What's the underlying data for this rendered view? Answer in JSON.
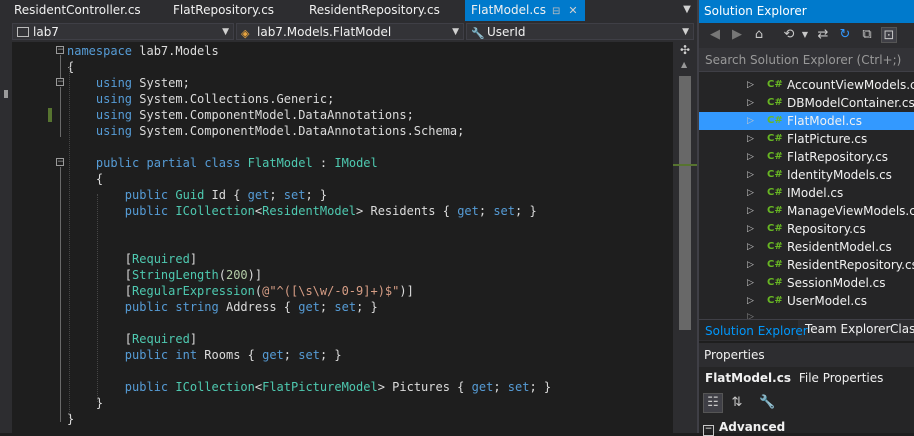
{
  "tabs": [
    {
      "label": "ResidentController.cs",
      "active": false
    },
    {
      "label": "FlatRepository.cs",
      "active": false
    },
    {
      "label": "ResidentRepository.cs",
      "active": false
    },
    {
      "label": "FlatModel.cs",
      "active": true
    }
  ],
  "navbar": {
    "project": "lab7",
    "type": "lab7.Models.FlatModel",
    "member": "UserId"
  },
  "code_lines": [
    [
      {
        "c": "kw",
        "t": "namespace"
      },
      {
        "c": "pl",
        "t": " lab7.Models"
      }
    ],
    [
      {
        "c": "pl",
        "t": "{"
      }
    ],
    [
      {
        "c": "pl",
        "t": "    "
      },
      {
        "c": "kw",
        "t": "using"
      },
      {
        "c": "pl",
        "t": " System;"
      }
    ],
    [
      {
        "c": "pl",
        "t": "    "
      },
      {
        "c": "kw",
        "t": "using"
      },
      {
        "c": "pl",
        "t": " System.Collections.Generic;"
      }
    ],
    [
      {
        "c": "pl",
        "t": "    "
      },
      {
        "c": "kw",
        "t": "using"
      },
      {
        "c": "pl",
        "t": " System.ComponentModel.DataAnnotations;"
      }
    ],
    [
      {
        "c": "pl",
        "t": "    "
      },
      {
        "c": "kw",
        "t": "using"
      },
      {
        "c": "pl",
        "t": " System.ComponentModel.DataAnnotations.Schema;"
      }
    ],
    [],
    [
      {
        "c": "pl",
        "t": "    "
      },
      {
        "c": "kw",
        "t": "public"
      },
      {
        "c": "pl",
        "t": " "
      },
      {
        "c": "kw",
        "t": "partial"
      },
      {
        "c": "pl",
        "t": " "
      },
      {
        "c": "kw",
        "t": "class"
      },
      {
        "c": "pl",
        "t": " "
      },
      {
        "c": "ty",
        "t": "FlatModel"
      },
      {
        "c": "pl",
        "t": " : "
      },
      {
        "c": "ty",
        "t": "IModel"
      }
    ],
    [
      {
        "c": "pl",
        "t": "    {"
      }
    ],
    [
      {
        "c": "pl",
        "t": "        "
      },
      {
        "c": "kw",
        "t": "public"
      },
      {
        "c": "pl",
        "t": " "
      },
      {
        "c": "ty",
        "t": "Guid"
      },
      {
        "c": "pl",
        "t": " Id { "
      },
      {
        "c": "kw",
        "t": "get"
      },
      {
        "c": "pl",
        "t": "; "
      },
      {
        "c": "kw",
        "t": "set"
      },
      {
        "c": "pl",
        "t": "; }"
      }
    ],
    [
      {
        "c": "pl",
        "t": "        "
      },
      {
        "c": "kw",
        "t": "public"
      },
      {
        "c": "pl",
        "t": " "
      },
      {
        "c": "ty",
        "t": "ICollection"
      },
      {
        "c": "pl",
        "t": "<"
      },
      {
        "c": "ty",
        "t": "ResidentModel"
      },
      {
        "c": "pl",
        "t": "> Residents { "
      },
      {
        "c": "kw",
        "t": "get"
      },
      {
        "c": "pl",
        "t": "; "
      },
      {
        "c": "kw",
        "t": "set"
      },
      {
        "c": "pl",
        "t": "; }"
      }
    ],
    [],
    [],
    [
      {
        "c": "pl",
        "t": "        ["
      },
      {
        "c": "ty",
        "t": "Required"
      },
      {
        "c": "pl",
        "t": "]"
      }
    ],
    [
      {
        "c": "pl",
        "t": "        ["
      },
      {
        "c": "ty",
        "t": "StringLength"
      },
      {
        "c": "pl",
        "t": "("
      },
      {
        "c": "nm",
        "t": "200"
      },
      {
        "c": "pl",
        "t": ")]"
      }
    ],
    [
      {
        "c": "pl",
        "t": "        ["
      },
      {
        "c": "ty",
        "t": "RegularExpression"
      },
      {
        "c": "pl",
        "t": "("
      },
      {
        "c": "st",
        "t": "@\"^([\\s\\w/-0-9]+)$\""
      },
      {
        "c": "pl",
        "t": ")]"
      }
    ],
    [
      {
        "c": "pl",
        "t": "        "
      },
      {
        "c": "kw",
        "t": "public"
      },
      {
        "c": "pl",
        "t": " "
      },
      {
        "c": "kw",
        "t": "string"
      },
      {
        "c": "pl",
        "t": " Address { "
      },
      {
        "c": "kw",
        "t": "get"
      },
      {
        "c": "pl",
        "t": "; "
      },
      {
        "c": "kw",
        "t": "set"
      },
      {
        "c": "pl",
        "t": "; }"
      }
    ],
    [],
    [
      {
        "c": "pl",
        "t": "        ["
      },
      {
        "c": "ty",
        "t": "Required"
      },
      {
        "c": "pl",
        "t": "]"
      }
    ],
    [
      {
        "c": "pl",
        "t": "        "
      },
      {
        "c": "kw",
        "t": "public"
      },
      {
        "c": "pl",
        "t": " "
      },
      {
        "c": "kw",
        "t": "int"
      },
      {
        "c": "pl",
        "t": " Rooms { "
      },
      {
        "c": "kw",
        "t": "get"
      },
      {
        "c": "pl",
        "t": "; "
      },
      {
        "c": "kw",
        "t": "set"
      },
      {
        "c": "pl",
        "t": "; }"
      }
    ],
    [],
    [
      {
        "c": "pl",
        "t": "        "
      },
      {
        "c": "kw",
        "t": "public"
      },
      {
        "c": "pl",
        "t": " "
      },
      {
        "c": "ty",
        "t": "ICollection"
      },
      {
        "c": "pl",
        "t": "<"
      },
      {
        "c": "ty",
        "t": "FlatPictureModel"
      },
      {
        "c": "pl",
        "t": "> Pictures { "
      },
      {
        "c": "kw",
        "t": "get"
      },
      {
        "c": "pl",
        "t": "; "
      },
      {
        "c": "kw",
        "t": "set"
      },
      {
        "c": "pl",
        "t": "; }"
      }
    ],
    [
      {
        "c": "pl",
        "t": "    }"
      }
    ],
    [
      {
        "c": "pl",
        "t": "}"
      }
    ]
  ],
  "solution_explorer": {
    "title": "Solution Explorer",
    "search_placeholder": "Search Solution Explorer (Ctrl+;)",
    "file_badge": "C#",
    "files": [
      {
        "name": "AccountViewModels.cs",
        "selected": false
      },
      {
        "name": "DBModelContainer.cs",
        "selected": false
      },
      {
        "name": "FlatModel.cs",
        "selected": true
      },
      {
        "name": "FlatPicture.cs",
        "selected": false
      },
      {
        "name": "FlatRepository.cs",
        "selected": false
      },
      {
        "name": "IdentityModels.cs",
        "selected": false
      },
      {
        "name": "IModel.cs",
        "selected": false
      },
      {
        "name": "ManageViewModels.cs",
        "selected": false
      },
      {
        "name": "Repository.cs",
        "selected": false
      },
      {
        "name": "ResidentModel.cs",
        "selected": false
      },
      {
        "name": "ResidentRepository.cs",
        "selected": false
      },
      {
        "name": "SessionModel.cs",
        "selected": false
      },
      {
        "name": "UserModel.cs",
        "selected": false
      }
    ],
    "bottom_tabs": [
      "Solution Explorer",
      "Team Explorer",
      "Class"
    ]
  },
  "properties": {
    "title": "Properties",
    "object_name": "FlatModel.cs",
    "object_type": "File Properties",
    "category": "Advanced"
  },
  "colors": {
    "accent": "#007acc",
    "selection": "#3399ff",
    "keyword": "#569cd6",
    "type": "#4ec9b0",
    "string": "#d69d85",
    "change_marker": "#577430"
  }
}
